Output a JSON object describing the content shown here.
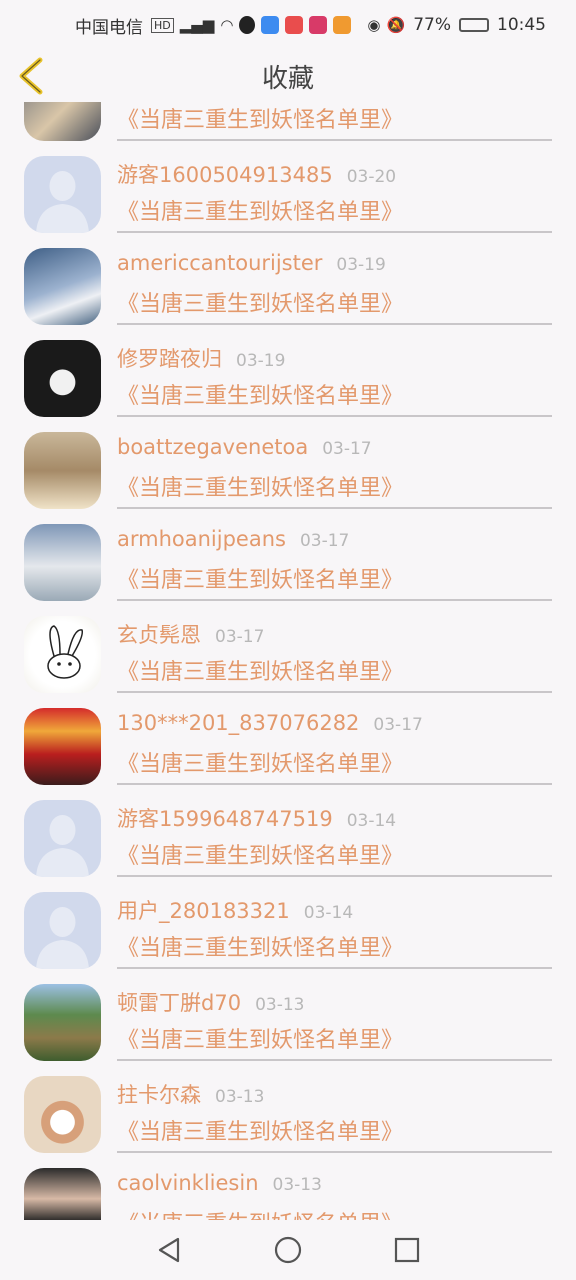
{
  "status_bar": {
    "carrier": "中国电信",
    "battery": "77%",
    "time": "10:45"
  },
  "header": {
    "title": "收藏",
    "back_icon": "chevron-left-icon",
    "accent": "#e8c32c"
  },
  "colors": {
    "accent_text": "#e3996c",
    "date_text": "#b8b8b8",
    "background": "#f8f6f8"
  },
  "items": [
    {
      "name": "",
      "date": "",
      "book": "《当唐三重生到妖怪名单里》",
      "avatar": "photo"
    },
    {
      "name": "游客1600504913485",
      "date": "03-20",
      "book": "《当唐三重生到妖怪名单里》",
      "avatar": "default"
    },
    {
      "name": "americcantourijster",
      "date": "03-19",
      "book": "《当唐三重生到妖怪名单里》",
      "avatar": "photo"
    },
    {
      "name": "修罗踏夜归",
      "date": "03-19",
      "book": "《当唐三重生到妖怪名单里》",
      "avatar": "photo"
    },
    {
      "name": "boattzegavenetoa",
      "date": "03-17",
      "book": "《当唐三重生到妖怪名单里》",
      "avatar": "photo"
    },
    {
      "name": "armhoanijpeans",
      "date": "03-17",
      "book": "《当唐三重生到妖怪名单里》",
      "avatar": "photo"
    },
    {
      "name": "玄贞髡恩",
      "date": "03-17",
      "book": "《当唐三重生到妖怪名单里》",
      "avatar": "drawing"
    },
    {
      "name": "130***201_837076282",
      "date": "03-17",
      "book": "《当唐三重生到妖怪名单里》",
      "avatar": "photo"
    },
    {
      "name": "游客1599648747519",
      "date": "03-14",
      "book": "《当唐三重生到妖怪名单里》",
      "avatar": "default"
    },
    {
      "name": "用户_280183321",
      "date": "03-14",
      "book": "《当唐三重生到妖怪名单里》",
      "avatar": "default"
    },
    {
      "name": "顿雷丁腁d70",
      "date": "03-13",
      "book": "《当唐三重生到妖怪名单里》",
      "avatar": "photo"
    },
    {
      "name": "拄卡尔森",
      "date": "03-13",
      "book": "《当唐三重生到妖怪名单里》",
      "avatar": "photo"
    },
    {
      "name": "caolvinkliesin",
      "date": "03-13",
      "book": "《当唐三重生到妖怪名单里》",
      "avatar": "photo"
    }
  ],
  "navbar": {
    "back": "triangle-back-icon",
    "home": "circle-home-icon",
    "recents": "square-recents-icon"
  }
}
